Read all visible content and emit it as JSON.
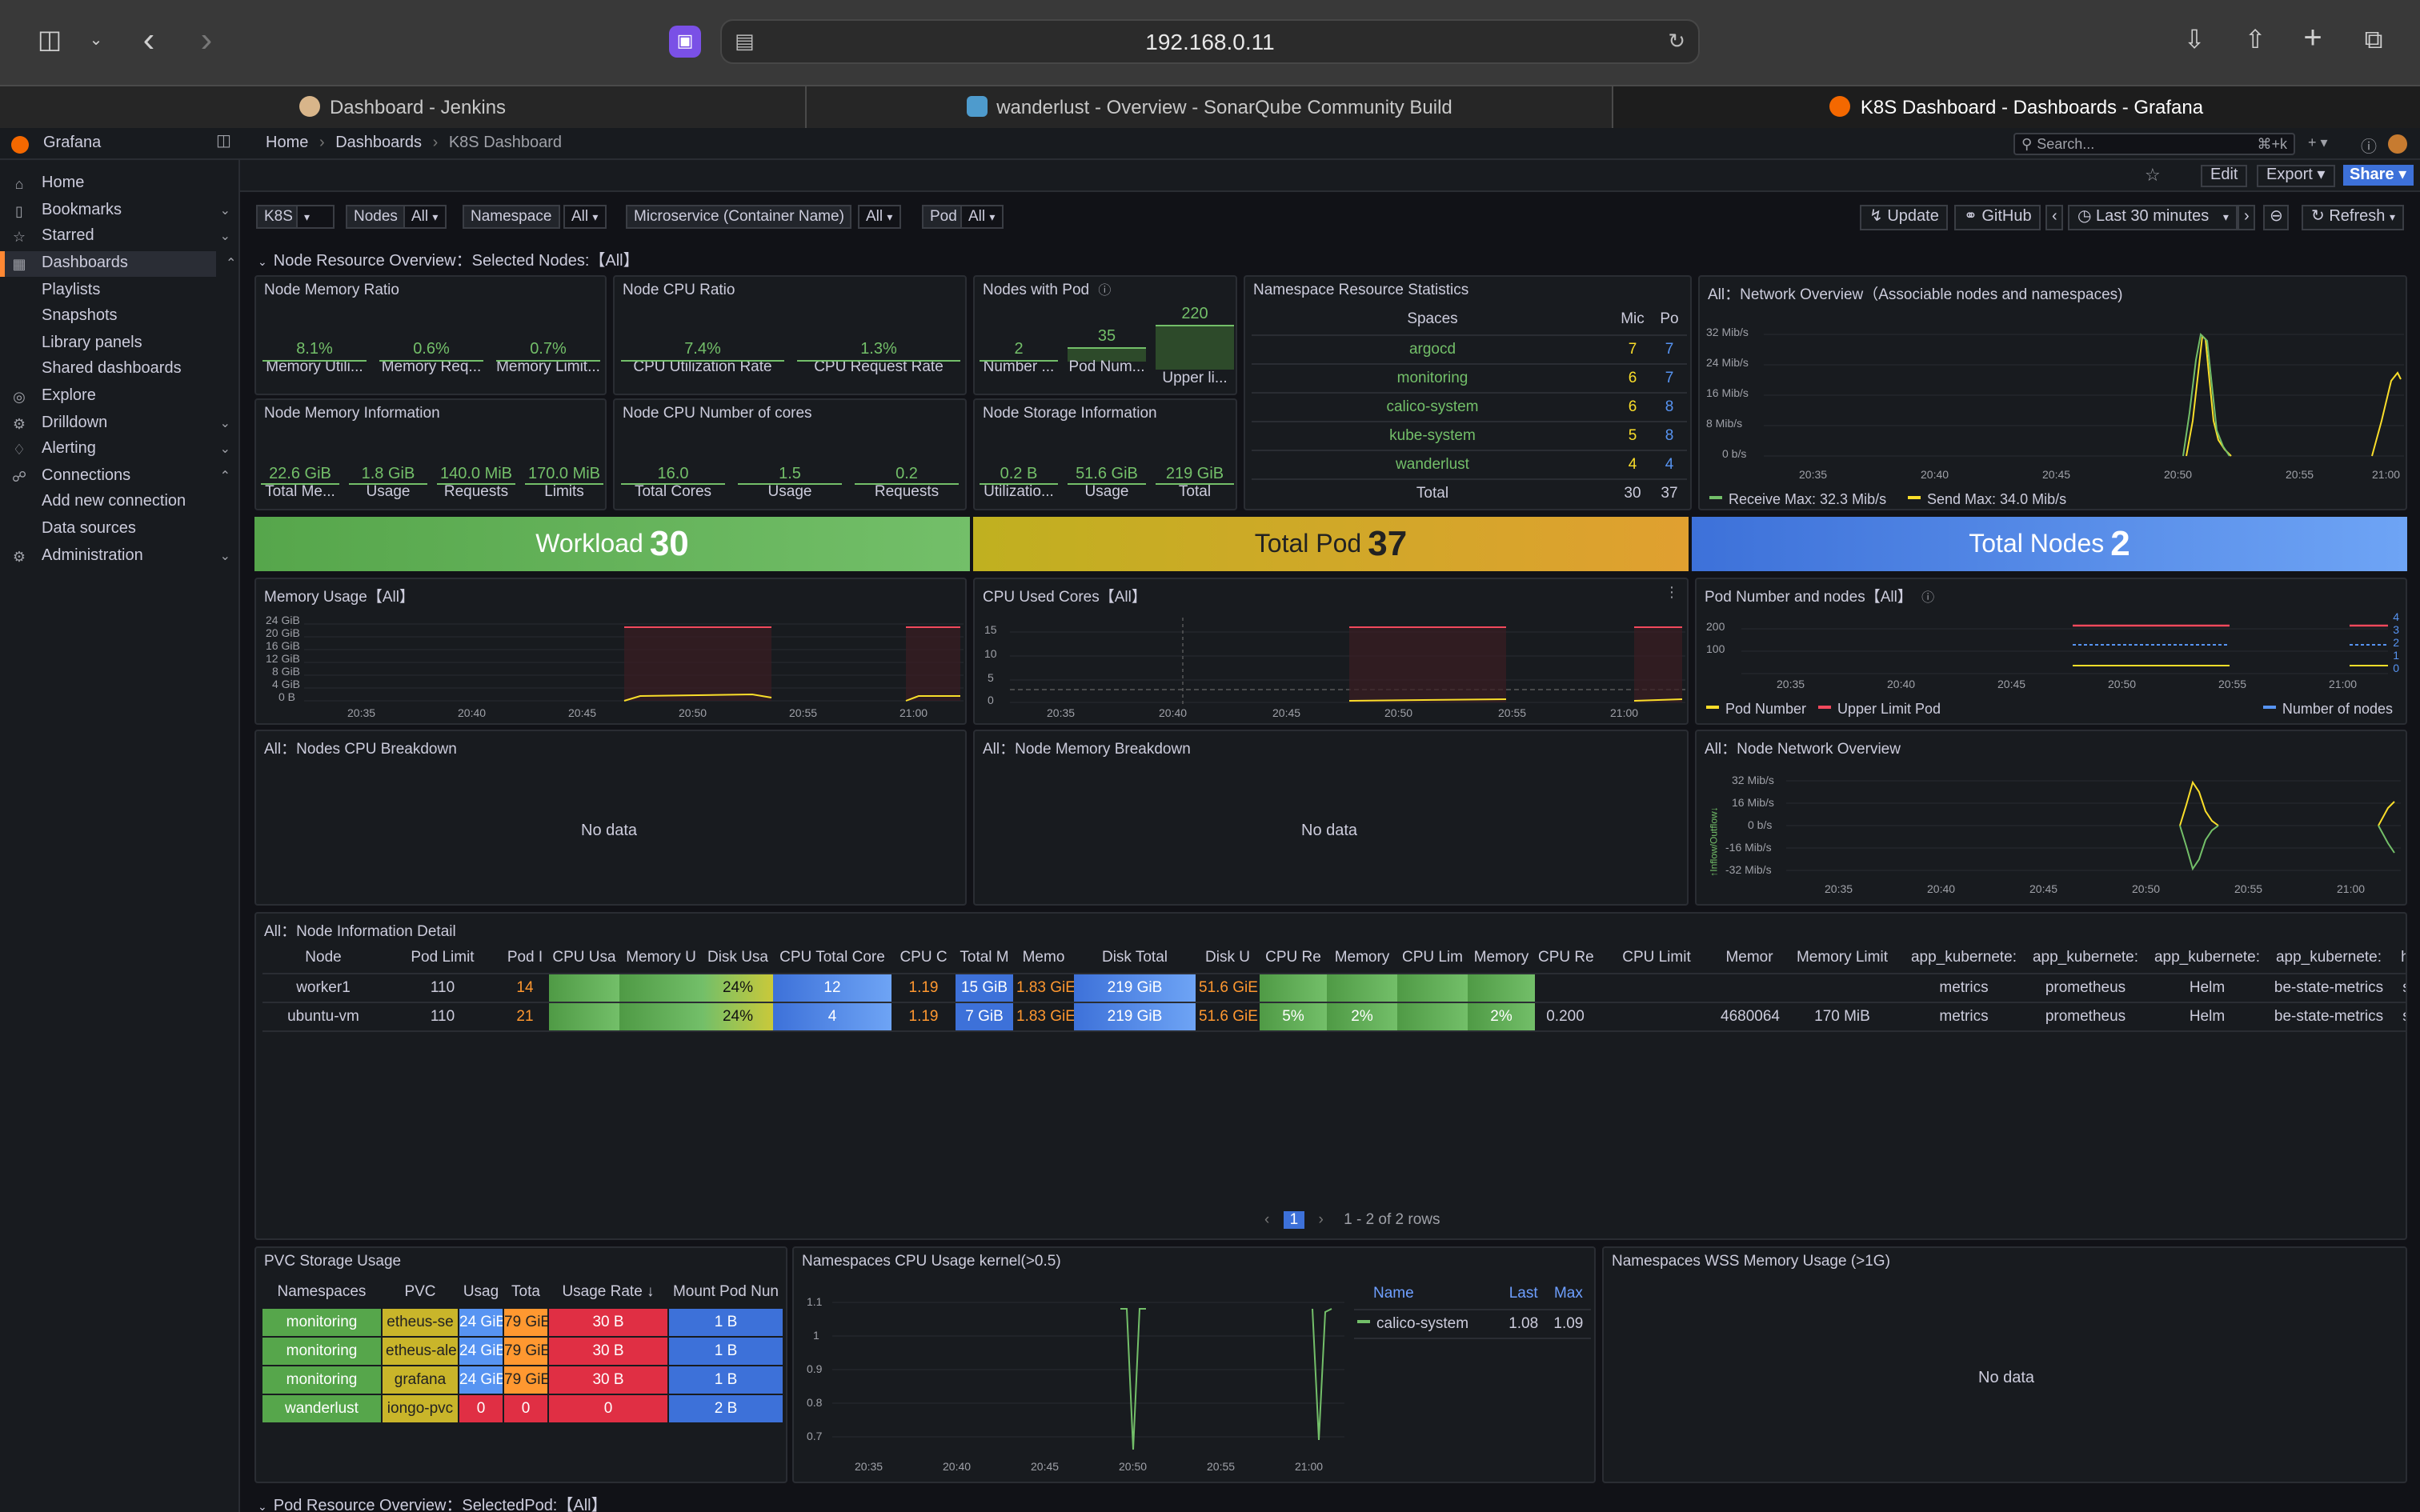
{
  "browser": {
    "url": "192.168.0.11",
    "tabs": [
      {
        "label": "Dashboard - Jenkins"
      },
      {
        "label": "wanderlust - Overview - SonarQube Community Build"
      },
      {
        "label": "K8S Dashboard - Dashboards - Grafana"
      }
    ]
  },
  "grafana": {
    "brand": "Grafana",
    "breadcrumb": [
      "Home",
      "Dashboards",
      "K8S Dashboard"
    ],
    "search_placeholder": "Search...",
    "search_shortcut": "⌘+k",
    "plus_label": "+ ▾",
    "edit_label": "Edit",
    "export_label": "Export",
    "share_label": "Share"
  },
  "sidebar": {
    "items": [
      {
        "label": "Home",
        "icon": "home-icon"
      },
      {
        "label": "Bookmarks",
        "icon": "bookmark-icon"
      },
      {
        "label": "Starred",
        "icon": "star-icon"
      },
      {
        "label": "Dashboards",
        "icon": "dashboards-icon"
      },
      {
        "label": "Playlists"
      },
      {
        "label": "Snapshots"
      },
      {
        "label": "Library panels"
      },
      {
        "label": "Shared dashboards"
      },
      {
        "label": "Explore",
        "icon": "compass-icon"
      },
      {
        "label": "Drilldown",
        "icon": "drilldown-icon"
      },
      {
        "label": "Alerting",
        "icon": "bell-icon"
      },
      {
        "label": "Connections",
        "icon": "connections-icon"
      },
      {
        "label": "Add new connection"
      },
      {
        "label": "Data sources"
      },
      {
        "label": "Administration",
        "icon": "gear-icon"
      }
    ]
  },
  "variables": {
    "k8s_label": "K8S",
    "k8s_value": "",
    "nodes_label": "Nodes",
    "nodes_value": "All",
    "namespace_label": "Namespace",
    "namespace_value": "All",
    "microservice_label": "Microservice (Container Name)",
    "microservice_value": "All",
    "pod_label": "Pod",
    "pod_value": "All"
  },
  "controls": {
    "update": "Update",
    "github": "GitHub",
    "time_range": "Last 30 minutes",
    "refresh": "Refresh"
  },
  "sections": {
    "node_overview": "Node Resource Overview：Selected Nodes:【All】",
    "pod_overview": "Pod Resource Overview：SelectedPod:【All】"
  },
  "panels": {
    "mem_ratio": {
      "title": "Node Memory Ratio",
      "stats": [
        {
          "value": "8.1%",
          "label": "Memory Utili..."
        },
        {
          "value": "0.6%",
          "label": "Memory Req..."
        },
        {
          "value": "0.7%",
          "label": "Memory Limit..."
        }
      ]
    },
    "cpu_ratio": {
      "title": "Node CPU Ratio",
      "stats": [
        {
          "value": "7.4%",
          "label": "CPU Utilization Rate"
        },
        {
          "value": "1.3%",
          "label": "CPU Request Rate"
        }
      ]
    },
    "nodes_with_pod": {
      "title": "Nodes with Pod",
      "stats": [
        {
          "value": "2",
          "label": "Number ..."
        },
        {
          "value": "35",
          "label": "Pod Num..."
        },
        {
          "value": "220",
          "label": "Upper li..."
        }
      ]
    },
    "mem_info": {
      "title": "Node Memory Information",
      "stats": [
        {
          "value": "22.6 GiB",
          "label": "Total Me..."
        },
        {
          "value": "1.8 GiB",
          "label": "Usage"
        },
        {
          "value": "140.0 MiB",
          "label": "Requests"
        },
        {
          "value": "170.0 MiB",
          "label": "Limits"
        }
      ]
    },
    "cpu_cores": {
      "title": "Node CPU Number of cores",
      "stats": [
        {
          "value": "16.0",
          "label": "Total Cores"
        },
        {
          "value": "1.5",
          "label": "Usage"
        },
        {
          "value": "0.2",
          "label": "Requests"
        }
      ]
    },
    "storage_info": {
      "title": "Node Storage Information",
      "stats": [
        {
          "value": "0.2 B",
          "label": "Utilizatio..."
        },
        {
          "value": "51.6 GiB",
          "label": "Usage"
        },
        {
          "value": "219 GiB",
          "label": "Total"
        }
      ]
    },
    "ns_stats": {
      "title": "Namespace Resource Statistics",
      "headers": [
        "Spaces",
        "Mic",
        "Po"
      ],
      "rows": [
        {
          "name": "argocd",
          "a": "7",
          "b": "7"
        },
        {
          "name": "monitoring",
          "a": "6",
          "b": "7"
        },
        {
          "name": "calico-system",
          "a": "6",
          "b": "8"
        },
        {
          "name": "kube-system",
          "a": "5",
          "b": "8"
        },
        {
          "name": "wanderlust",
          "a": "4",
          "b": "4"
        }
      ],
      "total_label": "Total",
      "total_a": "30",
      "total_b": "37"
    },
    "net_overview": {
      "title": "All：Network Overview（Associable nodes and namespaces)",
      "yticks": [
        "32 Mib/s",
        "24 Mib/s",
        "16 Mib/s",
        "8 Mib/s",
        "0 b/s"
      ],
      "xticks": [
        "20:35",
        "20:40",
        "20:45",
        "20:50",
        "20:55",
        "21:00"
      ],
      "legend_receive": "Receive  Max: 32.3 Mib/s",
      "legend_send": "Send  Max: 34.0 Mib/s"
    },
    "workload": {
      "label": "Workload",
      "value": "30"
    },
    "total_pod": {
      "label": "Total Pod",
      "value": "37"
    },
    "total_nodes": {
      "label": "Total Nodes",
      "value": "2"
    },
    "mem_usage": {
      "title": "Memory Usage【All】",
      "yticks": [
        "24 GiB",
        "20 GiB",
        "16 GiB",
        "12 GiB",
        "8 GiB",
        "4 GiB",
        "0 B"
      ],
      "xticks": [
        "20:35",
        "20:40",
        "20:45",
        "20:50",
        "20:55",
        "21:00"
      ]
    },
    "cpu_used": {
      "title": "CPU Used Cores【All】",
      "yticks": [
        "15",
        "10",
        "5",
        "0"
      ],
      "xticks": [
        "20:35",
        "20:40",
        "20:45",
        "20:50",
        "20:55",
        "21:00"
      ]
    },
    "pod_nodes": {
      "title": "Pod Number and nodes【All】",
      "yticks": [
        "200",
        "100"
      ],
      "yticks_right": [
        "4",
        "3",
        "2",
        "1",
        "0"
      ],
      "xticks": [
        "20:35",
        "20:40",
        "20:45",
        "20:50",
        "20:55",
        "21:00"
      ],
      "legend_pod": "Pod Number",
      "legend_upper": "Upper Limit Pod",
      "legend_nodes": "Number of nodes"
    },
    "cpu_breakdown": {
      "title": "All：Nodes CPU Breakdown",
      "nodata": "No data"
    },
    "mem_breakdown": {
      "title": "All：Node Memory Breakdown",
      "nodata": "No data"
    },
    "net_node": {
      "title": "All：Node Network Overview",
      "yticks": [
        "32 Mib/s",
        "16 Mib/s",
        "0 b/s",
        "-16 Mib/s",
        "-32 Mib/s"
      ],
      "ylabel": "↑Inflow/Outflow↓",
      "xticks": [
        "20:35",
        "20:40",
        "20:45",
        "20:50",
        "20:55",
        "21:00"
      ]
    },
    "node_detail": {
      "title": "All：Node Information Detail",
      "headers": [
        "Node",
        "Pod Limit",
        "Pod I",
        "CPU Usa",
        "Memory U",
        "Disk Usa",
        "CPU Total Core",
        "CPU C",
        "Total M",
        "Memo",
        "Disk Total",
        "Disk U",
        "CPU Re",
        "Memory",
        "CPU Lim",
        "Memory",
        "CPU Re",
        "CPU Limit",
        "Memor",
        "Memory Limit",
        "app_kubernete:",
        "app_kubernete:",
        "app_kubernete:",
        "app_kubernete:",
        "helm_"
      ],
      "rows": [
        [
          "worker1",
          "110",
          "14",
          "",
          "",
          "24%",
          "12",
          "1.19",
          "15 GiB",
          "1.83 GiE",
          "219 GiB",
          "51.6 GiE",
          "",
          "",
          "",
          "",
          "",
          "",
          "",
          "",
          "metrics",
          "prometheus",
          "Helm",
          "be-state-metrics",
          "state-"
        ],
        [
          "ubuntu-vm",
          "110",
          "21",
          "",
          "",
          "24%",
          "4",
          "1.19",
          "7 GiB",
          "1.83 GiE",
          "219 GiB",
          "51.6 GiE",
          "5%",
          "2%",
          "",
          "2%",
          "0.200",
          "",
          "4680064",
          "170 MiB",
          "metrics",
          "prometheus",
          "Helm",
          "be-state-metrics",
          "state-"
        ]
      ],
      "pager_page": "1",
      "pager_text": "1 - 2 of 2 rows"
    },
    "pvc": {
      "title": "PVC Storage Usage",
      "headers": [
        "Namespaces",
        "PVC",
        "Usag",
        "Tota",
        "Usage Rate ↓",
        "Mount Pod Nun"
      ],
      "rows": [
        [
          "monitoring",
          "etheus-se",
          "24 GiB",
          "79 GiE",
          "30 B",
          "1 B"
        ],
        [
          "monitoring",
          "etheus-ale",
          "24 GiB",
          "79 GiE",
          "30 B",
          "1 B"
        ],
        [
          "monitoring",
          "grafana",
          "24 GiB",
          "79 GiE",
          "30 B",
          "1 B"
        ],
        [
          "wanderlust",
          "iongo-pvc",
          "0",
          "0",
          "0",
          "2 B"
        ]
      ]
    },
    "ns_cpu": {
      "title": "Namespaces CPU Usage kernel(>0.5)",
      "yticks": [
        "1.1",
        "1",
        "0.9",
        "0.8",
        "0.7"
      ],
      "xticks": [
        "20:35",
        "20:40",
        "20:45",
        "20:50",
        "20:55",
        "21:00"
      ],
      "legend_headers": [
        "Name",
        "Last",
        "Max"
      ],
      "legend_row": {
        "name": "calico-system",
        "last": "1.08",
        "max": "1.09"
      }
    },
    "ns_wss": {
      "title": "Namespaces WSS Memory Usage (>1G)",
      "nodata": "No data"
    }
  },
  "colors": {
    "green": "#73bf69",
    "yellow": "#fade2a",
    "orange": "#ff9830",
    "red": "#f2495c",
    "blue": "#5794f2",
    "grafana_orange": "#ff8833"
  }
}
